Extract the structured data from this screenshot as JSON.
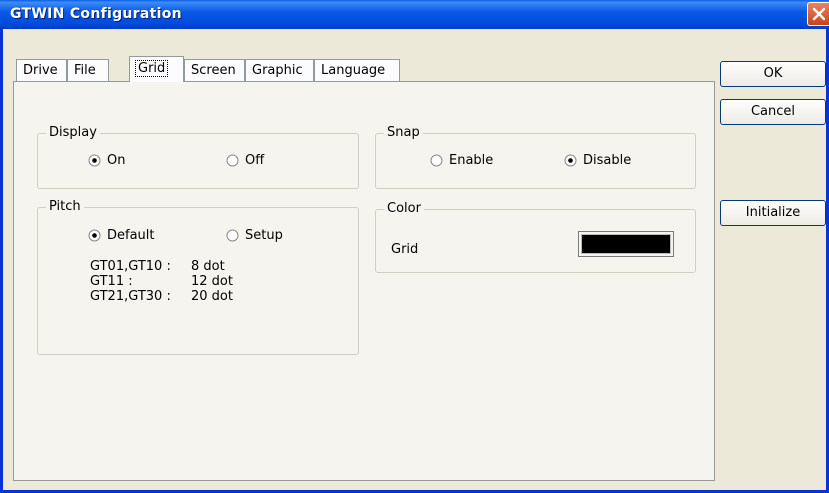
{
  "window": {
    "title": "GTWIN Configuration"
  },
  "tabs": [
    {
      "label": "Drive"
    },
    {
      "label": "File"
    },
    {
      "label": "Grid",
      "active": true
    },
    {
      "label": "Screen"
    },
    {
      "label": "Graphic"
    },
    {
      "label": "Language"
    }
  ],
  "buttons": {
    "ok": "OK",
    "cancel": "Cancel",
    "initialize": "Initialize"
  },
  "display": {
    "label": "Display",
    "on": "On",
    "off": "Off",
    "selected": "On"
  },
  "snap": {
    "label": "Snap",
    "enable": "Enable",
    "disable": "Disable",
    "selected": "Disable"
  },
  "pitch": {
    "label": "Pitch",
    "default": "Default",
    "setup": "Setup",
    "selected": "Default",
    "rows": [
      {
        "model": "GT01,GT10 :",
        "value": "8 dot"
      },
      {
        "model": "GT11 :",
        "value": "12 dot"
      },
      {
        "model": "GT21,GT30 :",
        "value": "20 dot"
      }
    ]
  },
  "color": {
    "label": "Color",
    "grid_label": "Grid",
    "grid_color": "#000000"
  }
}
